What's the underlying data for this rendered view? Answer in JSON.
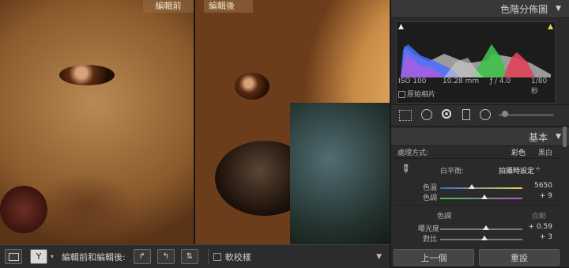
{
  "photo": {
    "before_label": "編輯前",
    "after_label": "編輯後"
  },
  "toolbar": {
    "compare_label": "編輯前和編輯後:",
    "softproof_label": "軟校樣"
  },
  "histogram": {
    "title": "色階分佈圖",
    "iso": "ISO 100",
    "focal": "10.28 mm",
    "aperture": "ƒ / 4.0",
    "shutter": "1/80 秒",
    "original_photo": "原始相片"
  },
  "basic": {
    "title": "基本",
    "treatment_label": "處理方式:",
    "treatment_color": "彩色",
    "treatment_bw": "黑白",
    "wb_label": "白平衡:",
    "wb_value": "拍攝時設定",
    "temp_label": "色溫",
    "temp_value": "5650",
    "tint_label": "色調",
    "tint_value": "+ 9",
    "tone_label": "色調",
    "auto_label": "自動",
    "exposure_label": "曝光度",
    "exposure_value": "+ 0.59",
    "contrast_label": "對比",
    "contrast_value": "+ 3"
  },
  "buttons": {
    "previous": "上一個",
    "reset": "重設"
  },
  "colors": {
    "panel_bg": "#2a2a2a",
    "header_bg": "#383838",
    "histogram_red": "#e0445a",
    "histogram_green": "#3fc14a",
    "histogram_blue": "#4a6cff"
  }
}
